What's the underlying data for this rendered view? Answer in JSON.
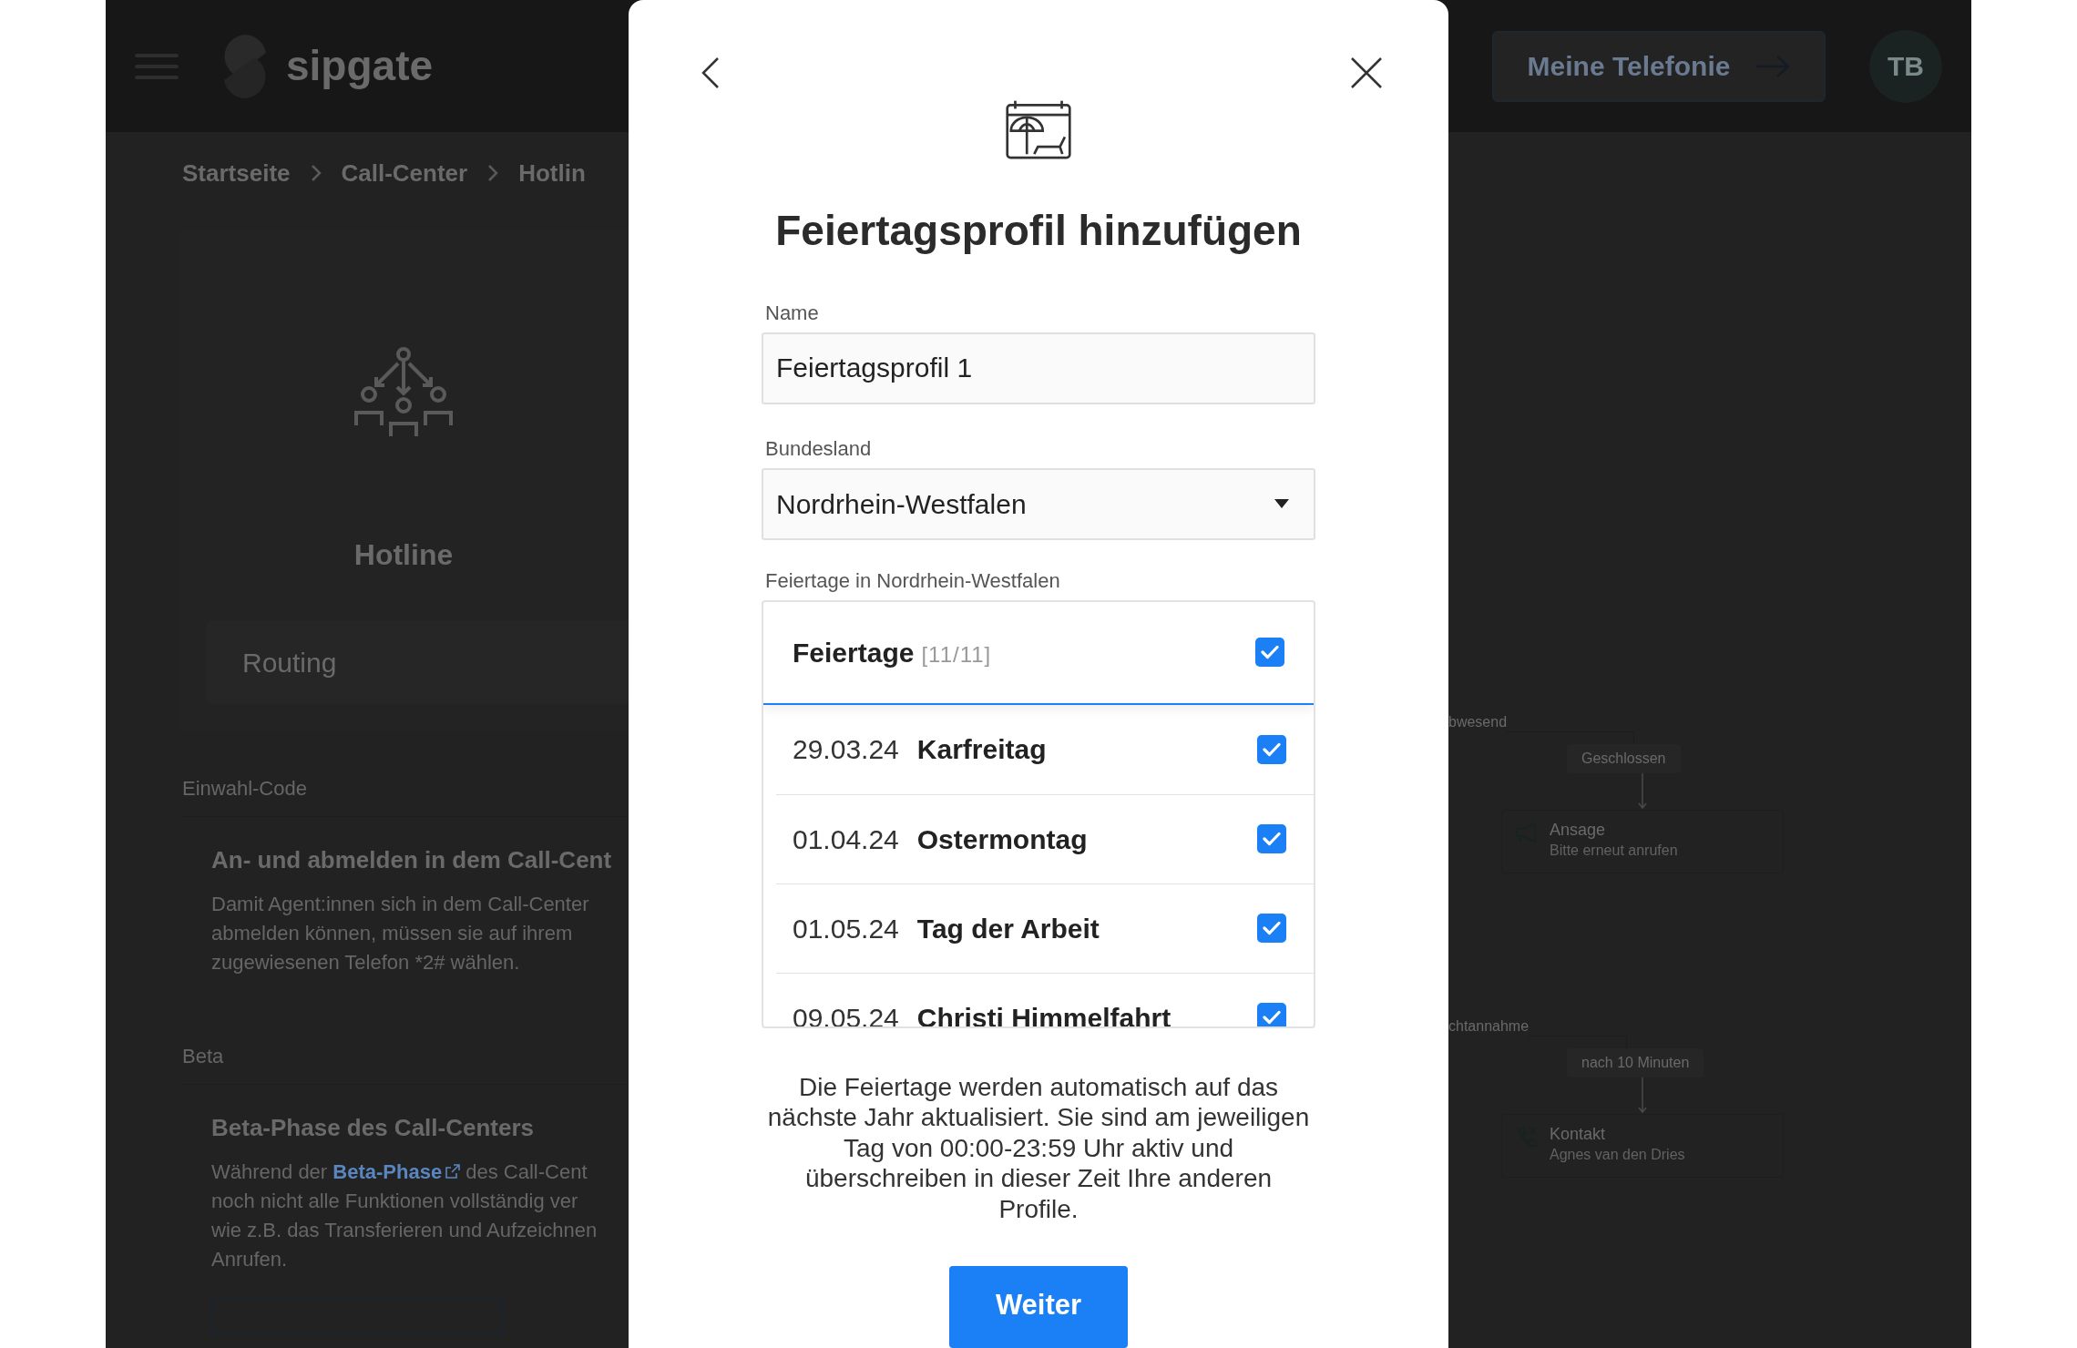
{
  "header": {
    "logo": "sipgate",
    "button": "Meine Telefonie",
    "avatar": "TB"
  },
  "breadcrumb": [
    "Startseite",
    "Call-Center",
    "Hotlin"
  ],
  "hotline": {
    "title": "Hotline",
    "tab": "Routing"
  },
  "sections": [
    {
      "label": "Einwahl-Code",
      "heading": "An- und abmelden in dem Call-Cent",
      "lines": [
        {
          "text": "Damit Agent:innen sich in dem Call-Center"
        },
        {
          "text": "abmelden können, müssen sie auf ihrem"
        },
        {
          "text": "zugewiesenen Telefon *2# wählen."
        }
      ]
    },
    {
      "label": "Beta",
      "heading": "Beta-Phase des Call-Centers",
      "lines": [
        {
          "text": "Während der ",
          "link": "Beta-Phase",
          "after": " des Call-Cent"
        },
        {
          "text": "noch nicht alle Funktionen vollständig ver"
        },
        {
          "text": "wie z.B. das Transferieren und Aufzeichnen"
        },
        {
          "text": "Anrufen."
        }
      ]
    }
  ],
  "routing": [
    {
      "kind": "branch",
      "label": "bwesend"
    },
    {
      "kind": "condition",
      "label": "Geschlossen"
    },
    {
      "kind": "node",
      "title": "Ansage",
      "subtitle": "Bitte erneut anrufen"
    },
    {
      "kind": "branch",
      "label": "chtannahme"
    },
    {
      "kind": "condition",
      "label": "nach 10 Minuten"
    },
    {
      "kind": "node",
      "title": "Kontakt",
      "subtitle": "Agnes van den Dries"
    }
  ],
  "modal": {
    "title": "Feiertagsprofil hinzufügen",
    "name_label": "Name",
    "name_value": "Feiertagsprofil 1",
    "state_label": "Bundesland",
    "state_value": "Nordrhein-Westfalen",
    "list_label": "Feiertage in Nordrhein-Westfalen",
    "list_header": {
      "label": "Feiertage",
      "count": "[11/11]",
      "checked": true
    },
    "holidays": [
      {
        "date": "29.03.24",
        "name": "Karfreitag",
        "checked": true
      },
      {
        "date": "01.04.24",
        "name": "Ostermontag",
        "checked": true
      },
      {
        "date": "01.05.24",
        "name": "Tag der Arbeit",
        "checked": true
      },
      {
        "date": "09.05.24",
        "name": "Christi Himmelfahrt",
        "checked": true
      }
    ],
    "note": "Die Feiertage werden automatisch auf das nächste Jahr aktualisiert. Sie sind am jeweiligen Tag von 00:00-23:59 Uhr aktiv und überschreiben in dieser Zeit Ihre anderen Profile.",
    "button": "Weiter"
  }
}
